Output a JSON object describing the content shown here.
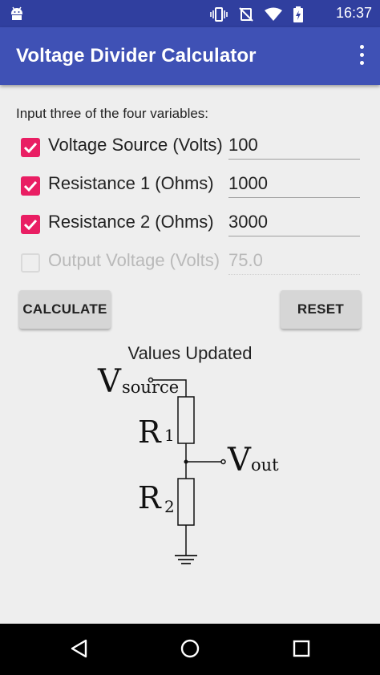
{
  "status_bar": {
    "time": "16:37"
  },
  "app_bar": {
    "title": "Voltage Divider Calculator"
  },
  "instructions": "Input three of the four variables:",
  "rows": [
    {
      "label": "Voltage Source (Volts)",
      "value": "100",
      "checked": true,
      "enabled": true
    },
    {
      "label": "Resistance 1 (Ohms)",
      "value": "1000",
      "checked": true,
      "enabled": true
    },
    {
      "label": "Resistance 2 (Ohms)",
      "value": "3000",
      "checked": true,
      "enabled": true
    },
    {
      "label": "Output Voltage (Volts)",
      "value": "75.0",
      "checked": false,
      "enabled": false
    }
  ],
  "buttons": {
    "calculate": "CALCULATE",
    "reset": "RESET"
  },
  "status_message": "Values Updated",
  "diagram": {
    "v_label": "V",
    "source_sub": "source",
    "r_label": "R",
    "r1_sub": "1",
    "r2_sub": "2",
    "out_sub": "out"
  },
  "colors": {
    "status_bar": "#303f9f",
    "app_bar": "#3f51b5",
    "checkbox": "#e91e63"
  },
  "icons": [
    "android-icon",
    "vibrate-icon",
    "no-sim-icon",
    "wifi-icon",
    "battery-charging-icon",
    "more-vert-icon",
    "back-icon",
    "home-icon",
    "recents-icon"
  ]
}
